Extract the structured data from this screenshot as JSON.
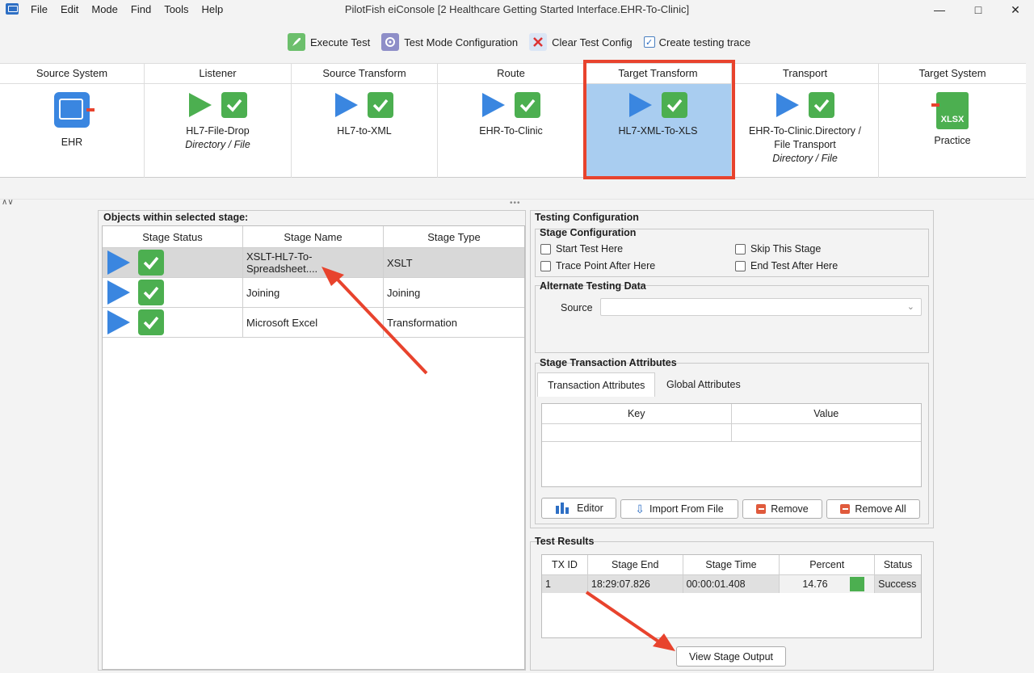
{
  "window": {
    "title": "PilotFish eiConsole [2 Healthcare Getting Started Interface.EHR-To-Clinic]",
    "menu": [
      "File",
      "Edit",
      "Mode",
      "Find",
      "Tools",
      "Help"
    ]
  },
  "toolbar": {
    "execute_test": "Execute Test",
    "test_mode_config": "Test Mode Configuration",
    "clear_test_config": "Clear Test Config",
    "create_trace": "Create testing trace",
    "create_trace_checked": true
  },
  "stages": [
    {
      "header": "Source System",
      "line1": "EHR",
      "line2": "",
      "line3": ""
    },
    {
      "header": "Listener",
      "line1": "HL7-File-Drop",
      "line2": "Directory / File",
      "line3": ""
    },
    {
      "header": "Source Transform",
      "line1": "HL7-to-XML",
      "line2": "",
      "line3": ""
    },
    {
      "header": "Route",
      "line1": "EHR-To-Clinic",
      "line2": "",
      "line3": ""
    },
    {
      "header": "Target Transform",
      "line1": "HL7-XML-To-XLS",
      "line2": "",
      "line3": ""
    },
    {
      "header": "Transport",
      "line1": "EHR-To-Clinic.Directory /",
      "line2": "File Transport",
      "line3": "Directory / File"
    },
    {
      "header": "Target System",
      "line1": "Practice",
      "line2": "",
      "line3": "",
      "icon_text": "XLSX"
    }
  ],
  "objects_panel": {
    "title": "Objects within selected stage:",
    "columns": [
      "Stage Status",
      "Stage Name",
      "Stage Type"
    ],
    "rows": [
      {
        "name": "XSLT-HL7-To-Spreadsheet....",
        "type": "XSLT"
      },
      {
        "name": "Joining",
        "type": "Joining"
      },
      {
        "name": "Microsoft Excel",
        "type": "Transformation"
      }
    ]
  },
  "testing_config": {
    "title": "Testing Configuration",
    "stage_config": {
      "title": "Stage Configuration",
      "start_test_here": "Start Test Here",
      "skip_this_stage": "Skip This Stage",
      "trace_point_after_here": "Trace Point After Here",
      "end_test_after_here": "End Test After Here"
    },
    "alt_data": {
      "title": "Alternate Testing Data",
      "source_label": "Source"
    },
    "attributes": {
      "title": "Stage Transaction Attributes",
      "tabs": [
        "Transaction Attributes",
        "Global Attributes"
      ],
      "columns": [
        "Key",
        "Value"
      ],
      "buttons": {
        "editor": "Editor",
        "import": "Import From File",
        "remove": "Remove",
        "remove_all": "Remove All"
      }
    }
  },
  "test_results": {
    "title": "Test Results",
    "columns": [
      "TX ID",
      "Stage End",
      "Stage Time",
      "Percent",
      "Status"
    ],
    "row": {
      "tx_id": "1",
      "stage_end": "18:29:07.826",
      "stage_time": "00:00:01.408",
      "percent": "14.76",
      "status": "Success"
    },
    "view_output": "View Stage Output"
  },
  "colors": {
    "accent_blue": "#3a86e0",
    "success_green": "#4caf50",
    "annotation_red": "#e8432d",
    "selected_stage": "#a9cdf0"
  }
}
